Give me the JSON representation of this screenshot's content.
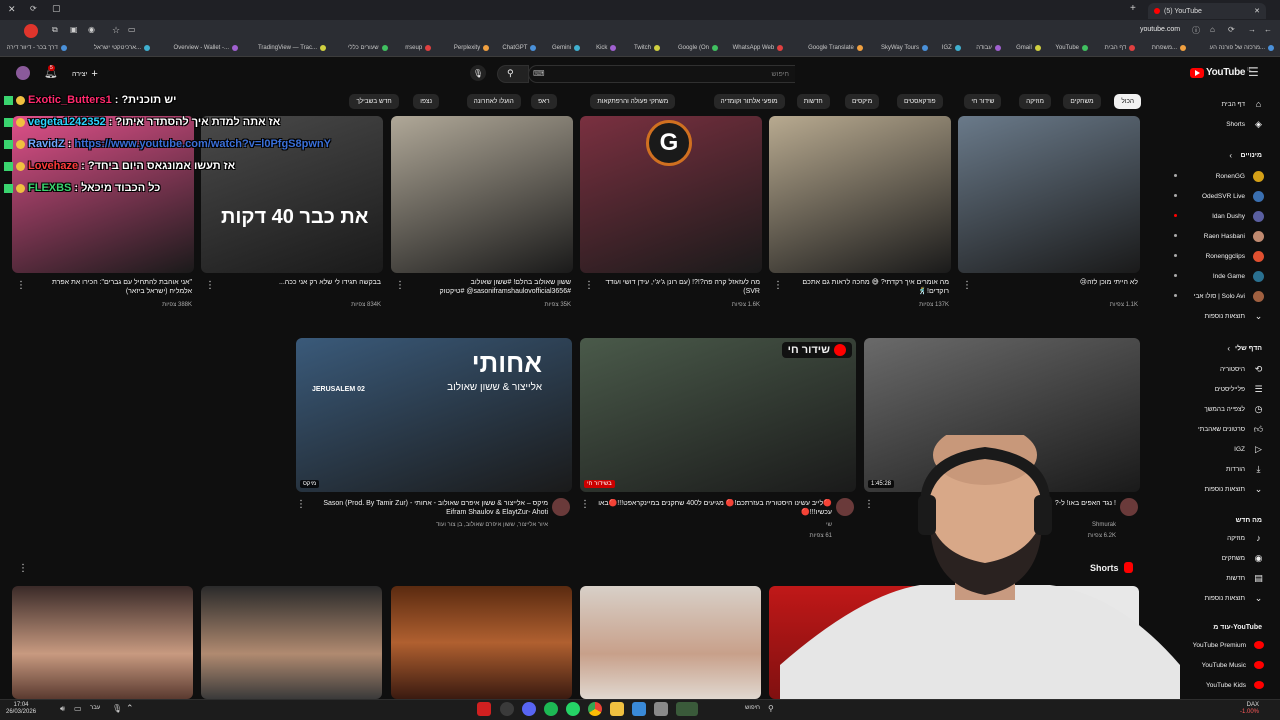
{
  "browser": {
    "tab_title": "(5) YouTube",
    "url": "youtube.com",
    "bookmarks": [
      "מרכזה של פורנה הע...",
      "משפחת...",
      "דף הבית",
      "YouTube",
      "Gmail",
      "עבודה",
      "IGZ",
      "SkyWay Tours",
      "Google Translate",
      "WhatsApp Web",
      "Google (On",
      "Twitch",
      "Kick",
      "Gemini",
      "ChatGPT",
      "Perplexity",
      "rrseup",
      "שעורים כללי",
      "TradingView — Trac...",
      "Overview - Wallet -...",
      "ארכיטקטי ישראל...",
      "דרך בכר - דיוור דירה",
      "טכלת כל הבינה הח..."
    ]
  },
  "header": {
    "logo_text": "YouTube",
    "country_code": "IL",
    "search_placeholder": "חיפוש",
    "create_label": "יצירה",
    "notification_count": "5"
  },
  "chips": [
    "הכול",
    "משחקים",
    "מוזיקה",
    "שידור חי",
    "פודקאסטים",
    "מיקסים",
    "חדשות",
    "מופעי אלתור וקומדיה",
    "משחקי פעולה והרפתקאות",
    "ראפ",
    "הועלו לאחרונה",
    "נצפו",
    "חדש בשבילך"
  ],
  "sidebar": {
    "main": [
      {
        "label": "דף הבית",
        "icon": "home-icon"
      },
      {
        "label": "Shorts",
        "icon": "shorts-icon"
      }
    ],
    "subscriptions_title": "מינויים",
    "subscriptions": [
      {
        "label": "RonenGG",
        "color": "#d4a017"
      },
      {
        "label": "OdedSVR Live",
        "color": "#3a6fb0"
      },
      {
        "label": "Idan Dushy",
        "color": "#5a5fa0"
      },
      {
        "label": "Raen Hasbani",
        "color": "#c08a70"
      },
      {
        "label": "Ronenggclips",
        "color": "#e05030"
      },
      {
        "label": "Inde Game",
        "color": "#2a7090"
      },
      {
        "label": "סולו אבי | Solo Avi",
        "color": "#a06040"
      }
    ],
    "subs_more": "תוצאות נוספות",
    "you_title": "הדף שלי",
    "you_items": [
      {
        "label": "היסטוריה",
        "icon": "history-icon"
      },
      {
        "label": "פלייליסטים",
        "icon": "playlist-icon"
      },
      {
        "label": "לצפייה בהמשך",
        "icon": "watch-later-icon"
      },
      {
        "label": "סרטונים שאהבתי",
        "icon": "like-icon"
      },
      {
        "label": "IGZ",
        "icon": "video-icon"
      },
      {
        "label": "הורדות",
        "icon": "download-icon"
      }
    ],
    "you_more": "תוצאות נוספות",
    "explore_title": "מה חדש",
    "explore_items": [
      {
        "label": "מוזיקה",
        "icon": "music-icon"
      },
      {
        "label": "משחקים",
        "icon": "gaming-icon"
      },
      {
        "label": "חדשות",
        "icon": "news-icon"
      }
    ],
    "explore_more": "תוצאות נוספות",
    "more_title": "עוד מ-YouTube",
    "more_items": [
      {
        "label": "YouTube Premium"
      },
      {
        "label": "YouTube Music"
      },
      {
        "label": "YouTube Kids"
      }
    ]
  },
  "row1": [
    {
      "title": "לא הייתי מוכן לזה😢",
      "meta": "1.1K צפיות",
      "bg": "#6a7a8a"
    },
    {
      "title": "מה אומרים איך רקדתי? 😅 מחכה לראות גם אתכם רוקדים!🕺",
      "meta": "137K צפיות",
      "bg": "#b8aa90"
    },
    {
      "title": "מה לעזאזל קרה פה?!?! (עם רונן ג'יג'י, עידן דושי ועודד SVR)",
      "meta": "1.6K צפיות",
      "bg": "#7a3040"
    },
    {
      "title": "ששון שאולוב בהלם! #ששון שאולוב #sasoniframshaulovofficial3656@ #טיקטוק",
      "meta": "35K צפיות",
      "bg": "#b0a898"
    },
    {
      "title": "בבקשה תגידו לי שלא רק אני ככה...",
      "meta": "834K צפיות",
      "bg": "#4a4a4a",
      "overlay": "את כבר 40 דקות"
    },
    {
      "title": "\"אני אוהבת להתחיל עם גברים\": הכירו את אפרת אלמליח (ישראל ביזאר)",
      "meta": "388K צפיות",
      "bg": "#e0508a"
    }
  ],
  "row2": [
    {
      "title": "! נגד האפים באו! ל-?",
      "channel": "Shmurak",
      "meta": "6.2K צפיות",
      "duration": "1:45:28",
      "bg": "#6a6a6a"
    },
    {
      "title": "🔴לייב עשינו היסטוריה בעזרתכם!🔴 מגיעים ל400 שחקנים במיינקראפט!!!🔴באו עכשיו!!!🔴",
      "channel": "שי",
      "meta": "61 צפיות",
      "badge": "שידור חי",
      "live_tag": "בשידור חי",
      "bg": "#4a5a4a"
    },
    {
      "title": "מיקס – אלייצור & ששון איפרם שאולוב - אחותי - Sason (Prod. By Tamir Zur) Eifram Shaulov & ElaytZur- Ahoti",
      "channel": "איור אלייצור, ששון איפרם שאולוב, בן צור ועוד",
      "badge_text": "מיקס",
      "thumb_title": "אחותי",
      "thumb_sub": "אלייצור & ששון שאולוב",
      "thumb_tag": "JERUSALEM 02",
      "bg": "#3a5a7a"
    }
  ],
  "shorts_title": "Shorts",
  "chat": [
    {
      "user": "Exotic_Butters1",
      "msg": "יש תוכנית?",
      "color": "#ff2a6d"
    },
    {
      "user": "vegeta1242352",
      "msg": "אז אתה למדת איך להסתדר איתו?",
      "color": "#2ad4ff"
    },
    {
      "user": "RavidZ",
      "msg": "https://www.youtube.com/watch?v=l0PfgS8pwnY",
      "color": "#6fa8ff"
    },
    {
      "user": "Lovehaze",
      "msg": "אז תעשו אמונגאס היום ביחד?",
      "color": "#ff3a3a"
    },
    {
      "user": "FLEXBS",
      "msg": "כל הכבוד מיכאל",
      "color": "#3ad46f"
    }
  ],
  "taskbar": {
    "time": "17:04",
    "date": "26/03/2026",
    "lang": "עבר",
    "search": "חיפוש",
    "weather": "DAX",
    "weather_val": "-1.00%"
  }
}
